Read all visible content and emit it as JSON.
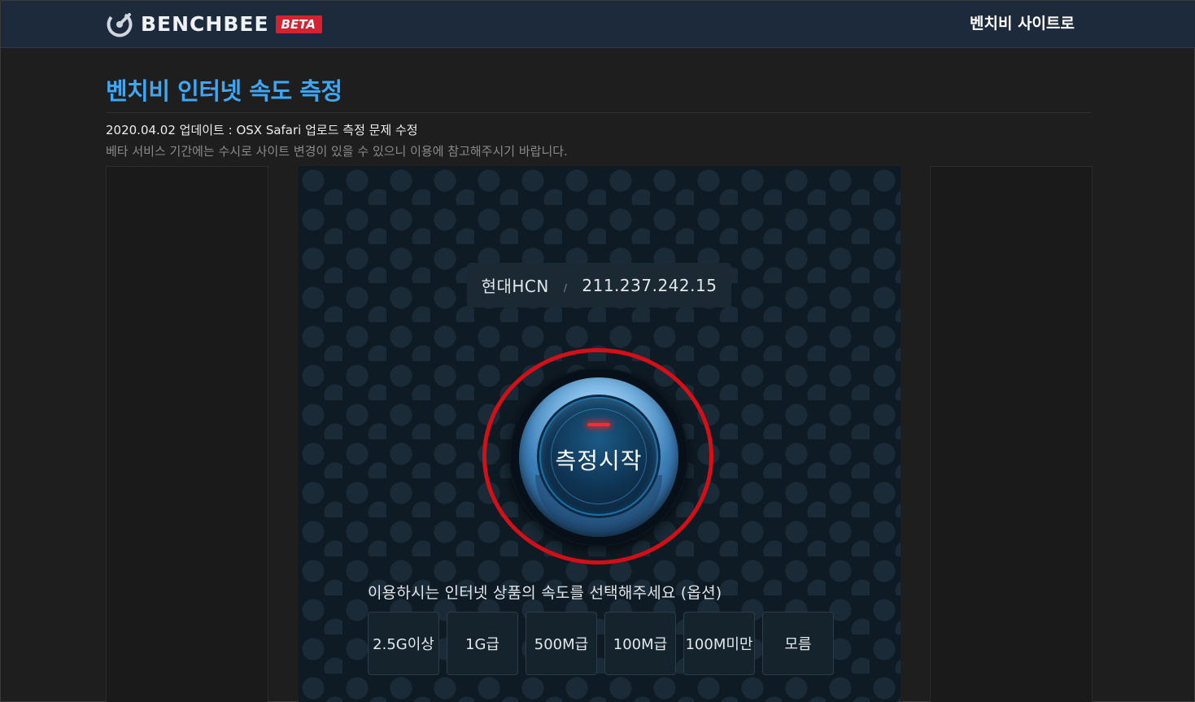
{
  "header": {
    "logo_text": "BENCHBEE",
    "badge": "BETA",
    "site_link": "벤치비 사이트로"
  },
  "page": {
    "title": "벤치비 인터넷 속도 측정",
    "update_note": "2020.04.02 업데이트 : OSX Safari 업로드 측정 문제 수정",
    "beta_note": "베타 서비스 기간에는 수시로 사이트 변경이 있을 수 있으니 이용에 참고해주시기 바랍니다."
  },
  "connection": {
    "isp": "현대HCN",
    "separator": "/",
    "ip": "211.237.242.15"
  },
  "start_button": {
    "label": "측정시작"
  },
  "speed_select": {
    "label": "이용하시는 인터넷 상품의 속도를 선택해주세요 (옵션)",
    "options": [
      "2.5G이상",
      "1G급",
      "500M급",
      "100M급",
      "100M미만",
      "모름"
    ]
  },
  "colors": {
    "header_bg": "#1d2a3c",
    "title_blue": "#3ea6f2",
    "badge_red": "#d32230",
    "highlight_ring": "#d50f17"
  },
  "icons": {
    "logo": "speedometer-icon"
  }
}
